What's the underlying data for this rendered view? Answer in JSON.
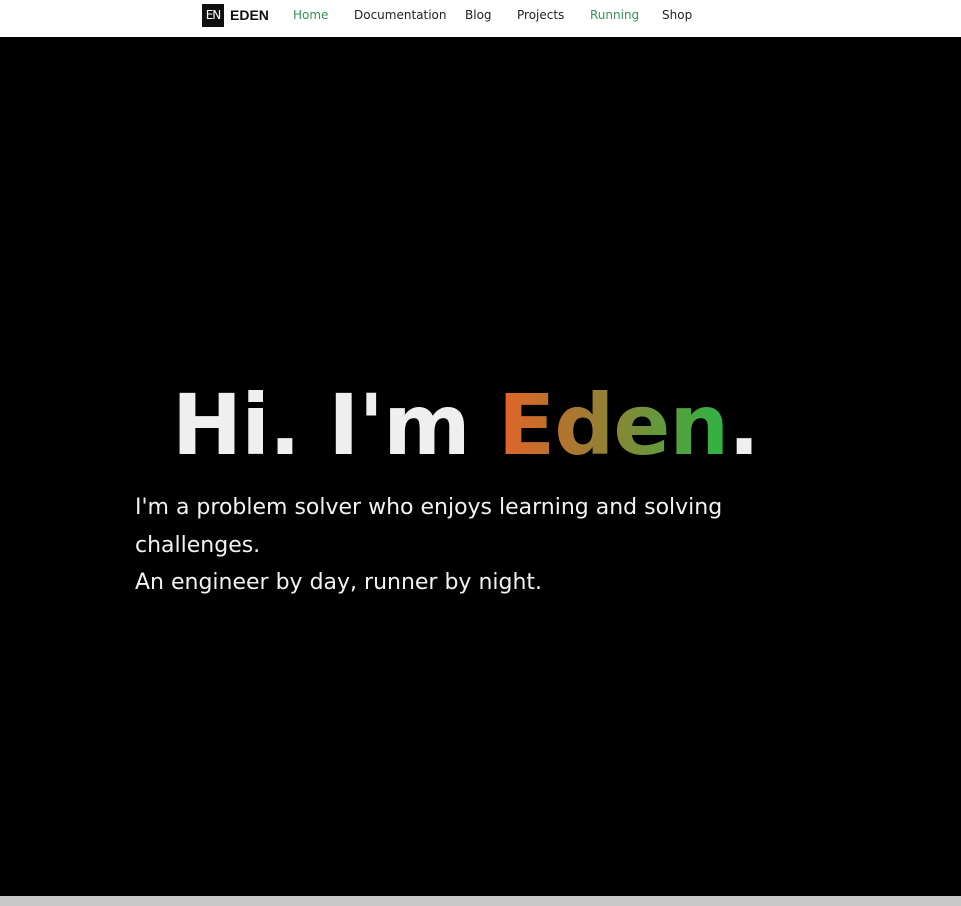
{
  "header": {
    "logo_badge": "EN",
    "logo_text": "EDEN",
    "nav": [
      {
        "label": "Home",
        "active": true
      },
      {
        "label": "Documentation",
        "active": false
      },
      {
        "label": "Blog",
        "active": false
      },
      {
        "label": "Projects",
        "active": false
      },
      {
        "label": "Running",
        "active": true
      },
      {
        "label": "Shop",
        "active": false
      }
    ]
  },
  "hero": {
    "greeting": "Hi. I'm ",
    "name": "Eden",
    "punct": ".",
    "intro_line1": "I'm a problem solver who enjoys learning and solving challenges.",
    "intro_line2": "An engineer by day, runner by night."
  },
  "colors": {
    "nav_active": "#3a8f5a",
    "gradient_start": "#e46327",
    "gradient_end": "#2bb644"
  }
}
